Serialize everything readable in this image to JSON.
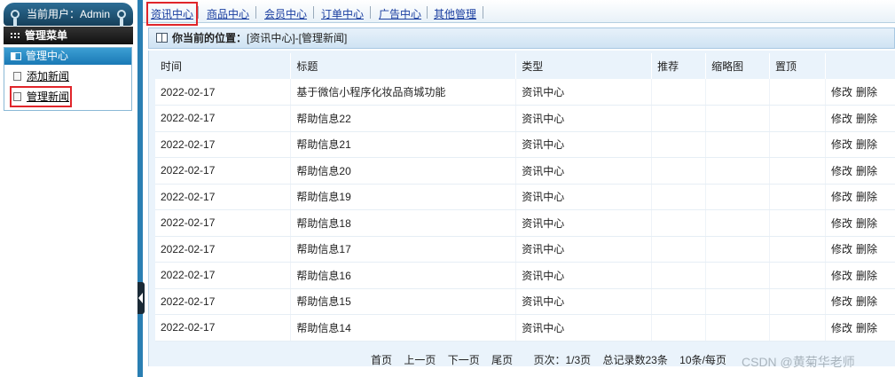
{
  "user": {
    "label": "当前用户：Admin"
  },
  "menu": {
    "title": "管理菜单"
  },
  "group": {
    "title": "管理中心",
    "items": [
      {
        "label": "添加新闻",
        "active": false
      },
      {
        "label": "管理新闻",
        "active": true
      }
    ]
  },
  "nav": {
    "items": [
      "资讯中心",
      "商品中心",
      "会员中心",
      "订单中心",
      "广告中心",
      "其他管理"
    ],
    "active_index": 0
  },
  "location": {
    "prefix": "你当前的位置：",
    "path": "[资讯中心]-[管理新闻]"
  },
  "table": {
    "headers": [
      "时间",
      "标题",
      "类型",
      "推荐",
      "缩略图",
      "置顶",
      ""
    ],
    "rows": [
      {
        "time": "2022-02-17",
        "title": "基于微信小程序化妆品商城功能",
        "type": "资讯中心"
      },
      {
        "time": "2022-02-17",
        "title": "帮助信息22",
        "type": "资讯中心"
      },
      {
        "time": "2022-02-17",
        "title": "帮助信息21",
        "type": "资讯中心"
      },
      {
        "time": "2022-02-17",
        "title": "帮助信息20",
        "type": "资讯中心"
      },
      {
        "time": "2022-02-17",
        "title": "帮助信息19",
        "type": "资讯中心"
      },
      {
        "time": "2022-02-17",
        "title": "帮助信息18",
        "type": "资讯中心"
      },
      {
        "time": "2022-02-17",
        "title": "帮助信息17",
        "type": "资讯中心"
      },
      {
        "time": "2022-02-17",
        "title": "帮助信息16",
        "type": "资讯中心"
      },
      {
        "time": "2022-02-17",
        "title": "帮助信息15",
        "type": "资讯中心"
      },
      {
        "time": "2022-02-17",
        "title": "帮助信息14",
        "type": "资讯中心"
      }
    ],
    "edit_label": "修改",
    "delete_label": "删除"
  },
  "pager": {
    "first": "首页",
    "prev": "上一页",
    "next": "下一页",
    "last": "尾页",
    "page_info": "页次：1/3页",
    "total": "总记录数23条",
    "per_page": "10条/每页"
  },
  "watermark": "CSDN @黄菊华老师",
  "colors": {
    "accent": "#2a7fb3",
    "highlight": "#e0252a",
    "link": "#1a3ea0"
  }
}
